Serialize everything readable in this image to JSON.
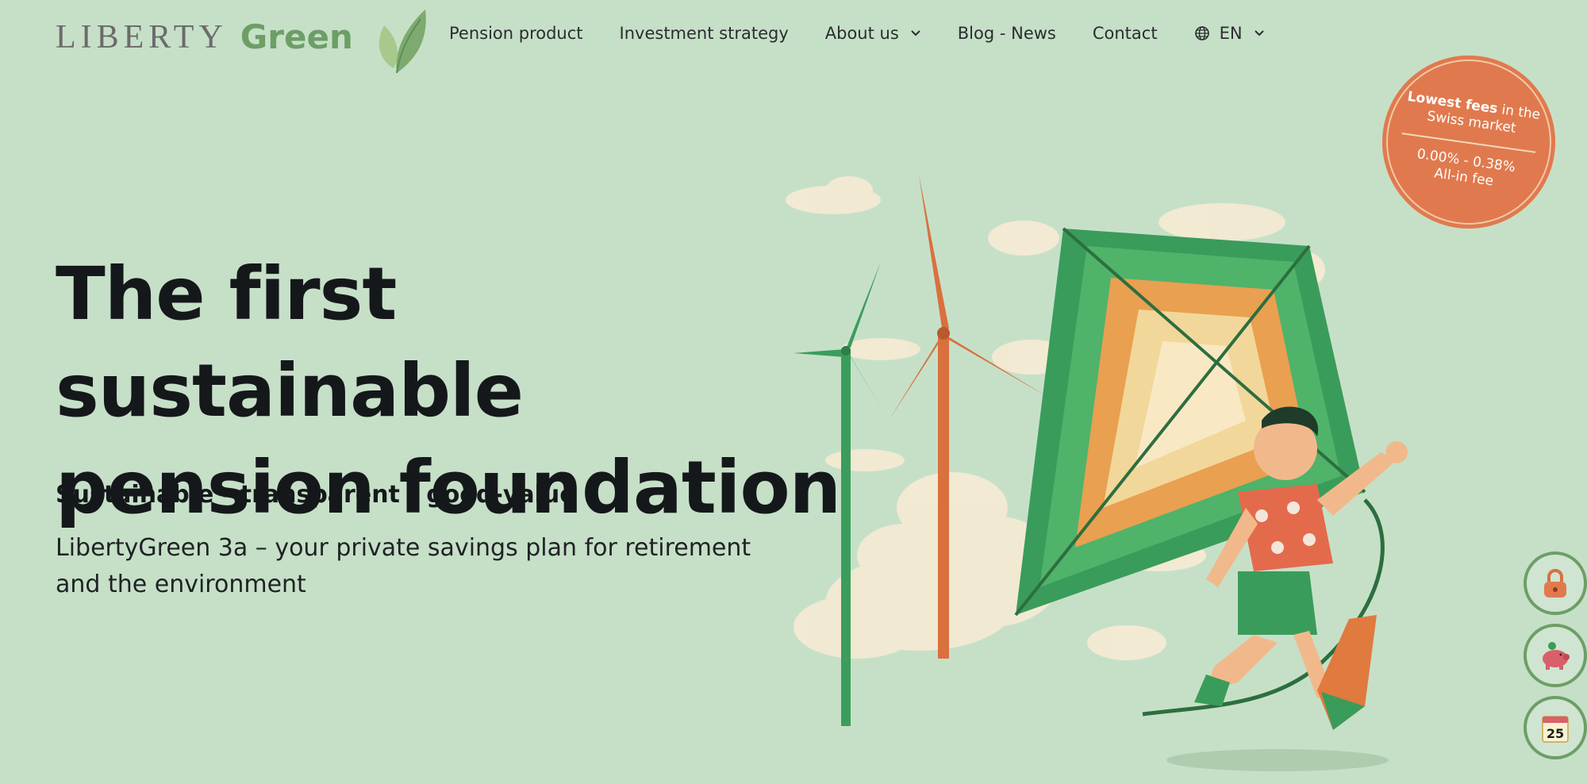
{
  "header": {
    "logo": {
      "part1": "LIBERTY",
      "part2": "Green"
    },
    "nav": [
      {
        "label": "Pension product"
      },
      {
        "label": "Investment strategy"
      },
      {
        "label": "About us"
      },
      {
        "label": "Blog - News"
      },
      {
        "label": "Contact"
      }
    ],
    "language": "EN"
  },
  "fee_badge": {
    "strong": "Lowest fees",
    "rest": " in the",
    "line2": "Swiss market",
    "range": "0.00% - 0.38%",
    "label": "All-in fee"
  },
  "hero": {
    "headline_line1": "The first sustainable",
    "headline_line2": "pension foundation",
    "subhead": "Sustainable - transparent - good-value",
    "description": "LibertyGreen 3a – your private savings plan for retirement and the environment"
  },
  "side_buttons": [
    {
      "icon": "lock-icon"
    },
    {
      "icon": "piggy-bank-icon"
    },
    {
      "icon": "calendar-icon",
      "day": "25"
    }
  ],
  "colors": {
    "background": "#c6e0c8",
    "brand_green": "#6d9e66",
    "badge_orange": "#e07a4e",
    "text_dark": "#15181b"
  }
}
